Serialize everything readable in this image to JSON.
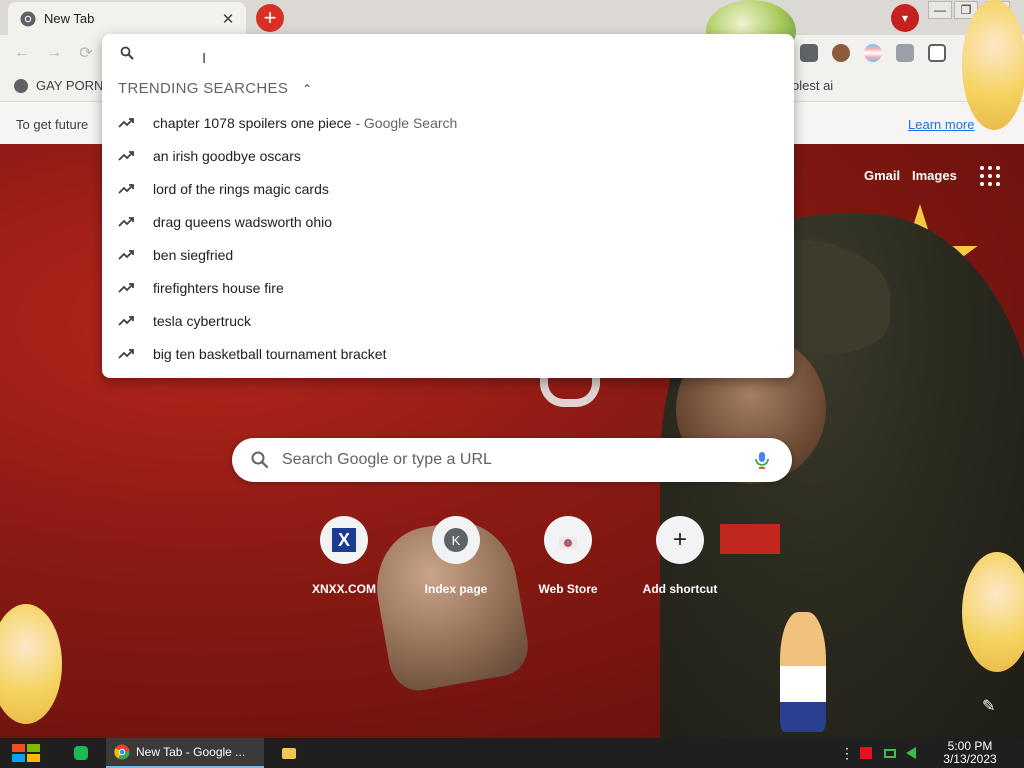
{
  "browser": {
    "tab_title": "New Tab",
    "close_glyph": "✕",
    "new_tab_glyph": "+",
    "tab_search_glyph": "▾",
    "window_controls": [
      "—",
      "❐",
      "✕"
    ],
    "nav": {
      "back": "←",
      "forward": "→",
      "reload": "⟳"
    }
  },
  "bookmarks": [
    {
      "label": "GAY PORN"
    },
    {
      "label": "olest ai"
    }
  ],
  "infobar": {
    "message": "To get future",
    "learn_more": "Learn more"
  },
  "omnibox": {
    "cursor_glyph": "I",
    "section_title": "TRENDING SEARCHES",
    "section_chevron": "⌃",
    "suggestions": [
      {
        "text": "chapter 1078 spoilers one piece",
        "suffix": " - Google Search"
      },
      {
        "text": "an irish goodbye oscars",
        "suffix": ""
      },
      {
        "text": "lord of the rings magic cards",
        "suffix": ""
      },
      {
        "text": "drag queens wadsworth ohio",
        "suffix": ""
      },
      {
        "text": "ben siegfried",
        "suffix": ""
      },
      {
        "text": "firefighters house fire",
        "suffix": ""
      },
      {
        "text": "tesla cybertruck",
        "suffix": ""
      },
      {
        "text": "big ten basketball tournament bracket",
        "suffix": ""
      }
    ]
  },
  "ntp": {
    "gmail": "Gmail",
    "images": "Images",
    "search_placeholder": "Search Google or type a URL",
    "shortcuts": [
      {
        "label": "XNXX.COM",
        "glyph": "X"
      },
      {
        "label": "Index page",
        "glyph": "K"
      },
      {
        "label": "Web Store",
        "glyph": ""
      },
      {
        "label": "Add shortcut",
        "glyph": "+"
      }
    ],
    "edit_glyph": "✎"
  },
  "taskbar": {
    "chrome_item": "New Tab - Google ...",
    "time": "5:00 PM",
    "date": "3/13/2023"
  },
  "colors": {
    "accent_red": "#d93025",
    "link_blue": "#1a73e8",
    "flag_yellow": "#f6c945"
  }
}
